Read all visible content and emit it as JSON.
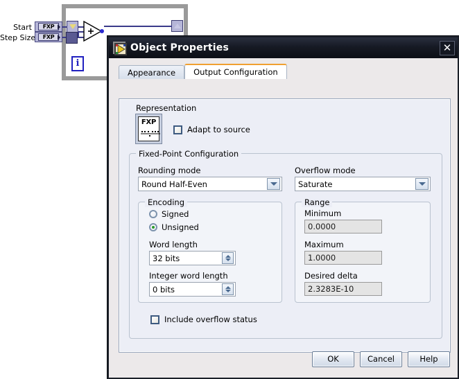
{
  "diagram": {
    "terminals": [
      {
        "label": "Start",
        "type": "FXP"
      },
      {
        "label": "Step Size",
        "type": "FXP"
      }
    ],
    "iteration_terminal": "i",
    "add_node_symbol": "+"
  },
  "dialog": {
    "title": "Object Properties",
    "window_icon": "labview-vi-icon",
    "close_label": "✕",
    "tabs": [
      {
        "label": "Appearance",
        "active": false
      },
      {
        "label": "Output Configuration",
        "active": true
      }
    ],
    "representation": {
      "section_label": "Representation",
      "icon_text": "FXP",
      "adapt_to_source": {
        "label": "Adapt to source",
        "checked": false
      }
    },
    "fixed_point": {
      "group_title": "Fixed-Point Configuration",
      "rounding_mode": {
        "label": "Rounding mode",
        "value": "Round Half-Even"
      },
      "overflow_mode": {
        "label": "Overflow mode",
        "value": "Saturate"
      },
      "encoding": {
        "group_title": "Encoding",
        "signed": {
          "label": "Signed",
          "selected": false
        },
        "unsigned": {
          "label": "Unsigned",
          "selected": true
        },
        "word_length": {
          "label": "Word length",
          "value": "32 bits"
        },
        "integer_word_length": {
          "label": "Integer word length",
          "value": "0 bits"
        }
      },
      "range": {
        "group_title": "Range",
        "minimum": {
          "label": "Minimum",
          "value": "0.0000"
        },
        "maximum": {
          "label": "Maximum",
          "value": "1.0000"
        },
        "desired_delta": {
          "label": "Desired delta",
          "value": "2.3283E-10"
        }
      },
      "include_overflow_status": {
        "label": "Include overflow status",
        "checked": false
      }
    },
    "buttons": {
      "ok": "OK",
      "cancel": "Cancel",
      "help": "Help"
    }
  },
  "colors": {
    "titlebar": "#0c0f16",
    "active_tab_accent": "#f0a030",
    "panel_bg": "#eceef6",
    "dialog_bg": "#ece9ea",
    "radio_selected": "#2a9a2a"
  }
}
